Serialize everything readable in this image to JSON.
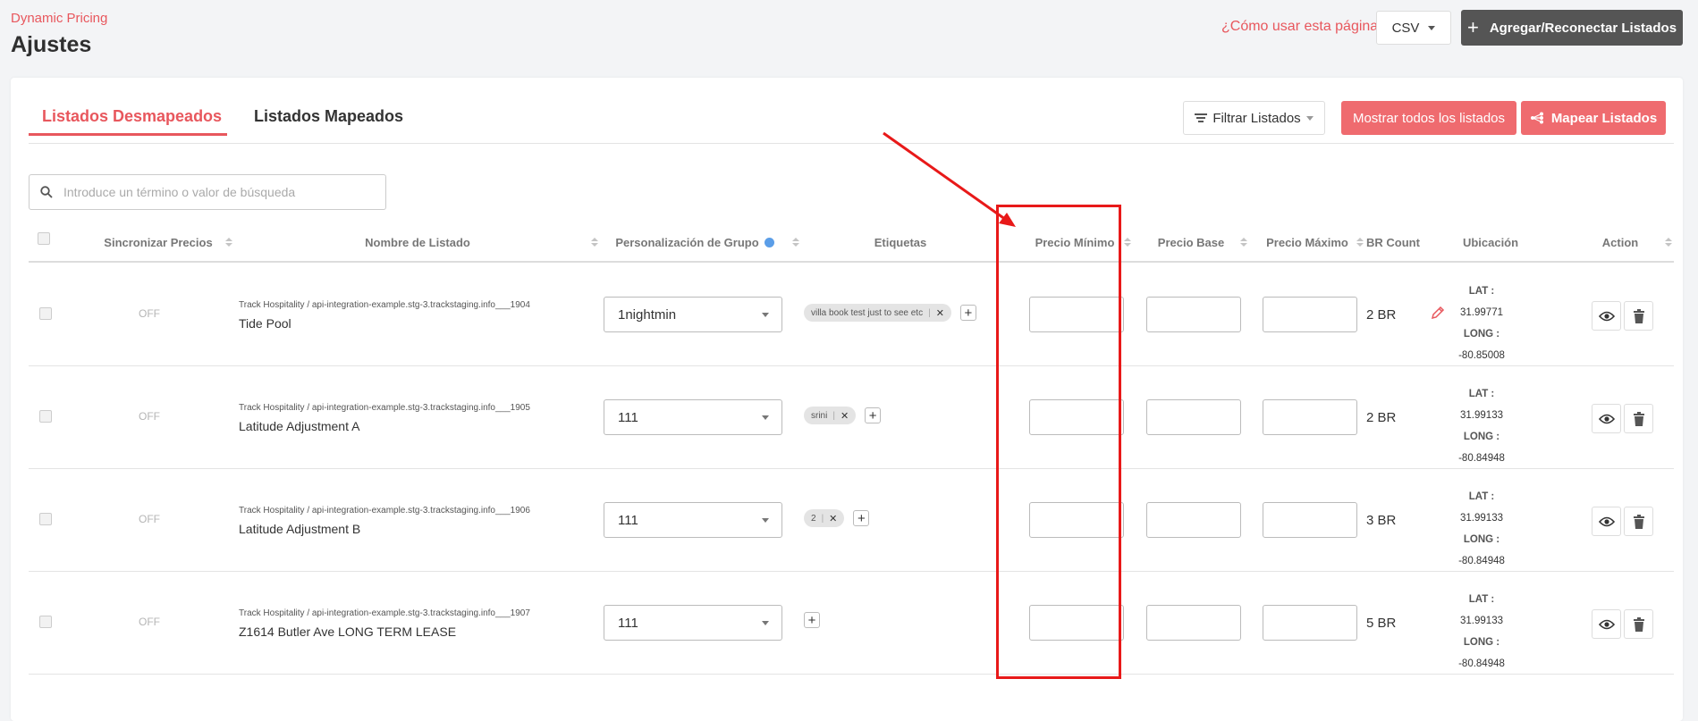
{
  "header": {
    "breadcrumb": "Dynamic Pricing",
    "title": "Ajustes",
    "help_link": "¿Cómo usar esta página?",
    "csv_label": "CSV",
    "add_button": "Agregar/Reconectar Listados"
  },
  "tabs": {
    "unmapped": "Listados Desmapeados",
    "mapped": "Listados Mapeados"
  },
  "toolbar": {
    "filter_label": "Filtrar Listados",
    "show_all_label": "Mostrar todos los listados",
    "map_label": "Mapear Listados"
  },
  "search": {
    "placeholder": "Introduce un término o valor de búsqueda"
  },
  "table": {
    "headers": {
      "sync": "Sincronizar Precios",
      "name": "Nombre de Listado",
      "group": "Personalización de Grupo",
      "tags": "Etiquetas",
      "min_price": "Precio Mínimo",
      "base_price": "Precio Base",
      "max_price": "Precio Máximo",
      "br_count": "BR Count",
      "location": "Ubicación",
      "action": "Action"
    },
    "lat_label": "LAT :",
    "long_label": "LONG :",
    "rows": [
      {
        "sync": "OFF",
        "path": "Track Hospitality / api-integration-example.stg-3.trackstaging.info___1904",
        "name": "Tide Pool",
        "group": "1nightmin",
        "tags": [
          "villa book test just to see etc"
        ],
        "br": "2 BR",
        "lat": "31.99771",
        "long": "-80.85008"
      },
      {
        "sync": "OFF",
        "path": "Track Hospitality / api-integration-example.stg-3.trackstaging.info___1905",
        "name": "Latitude Adjustment A",
        "group": "111",
        "tags": [
          "srini"
        ],
        "br": "2 BR",
        "lat": "31.99133",
        "long": "-80.84948"
      },
      {
        "sync": "OFF",
        "path": "Track Hospitality / api-integration-example.stg-3.trackstaging.info___1906",
        "name": "Latitude Adjustment B",
        "group": "111",
        "tags": [
          "2"
        ],
        "br": "3 BR",
        "lat": "31.99133",
        "long": "-80.84948"
      },
      {
        "sync": "OFF",
        "path": "Track Hospitality / api-integration-example.stg-3.trackstaging.info___1907",
        "name": "Z1614 Butler Ave LONG TERM LEASE",
        "group": "111",
        "tags": [],
        "br": "5 BR",
        "lat": "31.99133",
        "long": "-80.84948"
      }
    ]
  },
  "colors": {
    "accent": "#e8575d",
    "button_red": "#ef6b6f",
    "dark_button": "#555555",
    "annotation_red": "#e81919"
  }
}
